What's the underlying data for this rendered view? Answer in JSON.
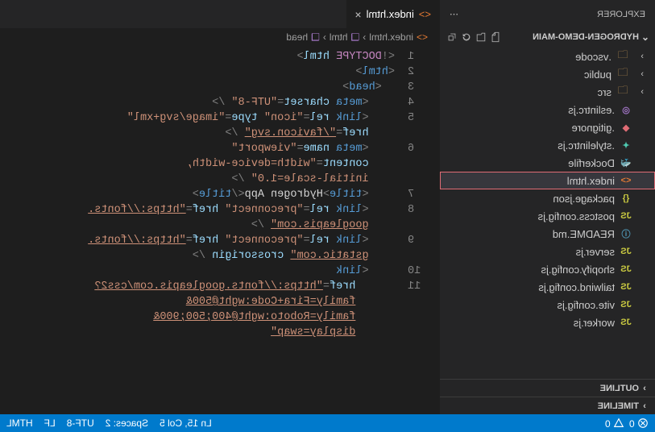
{
  "sidebar": {
    "title": "EXPLORER",
    "project": "HYDROGEN-DEMO-MAIN",
    "toolbar": {
      "newFile": "new-file",
      "newFolder": "new-folder",
      "refresh": "refresh",
      "collapse": "collapse"
    },
    "items": [
      {
        "kind": "folder",
        "label": ".vscode"
      },
      {
        "kind": "folder",
        "label": "public"
      },
      {
        "kind": "folder",
        "label": "src"
      },
      {
        "kind": "file",
        "label": ".eslintrc.js",
        "icon": "◎",
        "iconColor": "#a074c4"
      },
      {
        "kind": "file",
        "label": ".gitignore",
        "icon": "◆",
        "iconColor": "#e06c75"
      },
      {
        "kind": "file",
        "label": ".stylelintrc.js",
        "icon": "✦",
        "iconColor": "#4ec9b0"
      },
      {
        "kind": "file",
        "label": "Dockerfile",
        "icon": "🐳",
        "iconColor": "#519aba"
      },
      {
        "kind": "file",
        "label": "index.html",
        "icon": "<>",
        "iconColor": "#e37933",
        "selected": true
      },
      {
        "kind": "file",
        "label": "package.json",
        "icon": "{}",
        "iconColor": "#cbcb41"
      },
      {
        "kind": "file",
        "label": "postcss.config.js",
        "icon": "JS",
        "iconColor": "#cbcb41"
      },
      {
        "kind": "file",
        "label": "README.md",
        "icon": "ⓘ",
        "iconColor": "#519aba"
      },
      {
        "kind": "file",
        "label": "server.js",
        "icon": "JS",
        "iconColor": "#cbcb41"
      },
      {
        "kind": "file",
        "label": "shopify.config.js",
        "icon": "JS",
        "iconColor": "#cbcb41"
      },
      {
        "kind": "file",
        "label": "tailwind.config.js",
        "icon": "JS",
        "iconColor": "#cbcb41"
      },
      {
        "kind": "file",
        "label": "vite.config.js",
        "icon": "JS",
        "iconColor": "#cbcb41"
      },
      {
        "kind": "file",
        "label": "worker.js",
        "icon": "JS",
        "iconColor": "#cbcb41"
      }
    ],
    "sections": [
      {
        "label": "OUTLINE"
      },
      {
        "label": "TIMELINE"
      }
    ]
  },
  "tab": {
    "label": "index.html",
    "fileIcon": "<>"
  },
  "breadcrumb": {
    "file": "index.html",
    "path": [
      "html",
      "head"
    ]
  },
  "code": {
    "lines": [
      {
        "n": 1,
        "segs": [
          [
            "p",
            "<!"
          ],
          [
            "k",
            "DOCTYPE"
          ],
          [
            "tx",
            " "
          ],
          [
            "a",
            "html"
          ],
          [
            "p",
            ">"
          ]
        ],
        "ind": 0
      },
      {
        "n": 2,
        "segs": [
          [
            "p",
            "<"
          ],
          [
            "t",
            "html"
          ],
          [
            "p",
            ">"
          ]
        ],
        "ind": 0
      },
      {
        "n": 3,
        "segs": [
          [
            "p",
            "<"
          ],
          [
            "t",
            "head"
          ],
          [
            "p",
            ">"
          ]
        ],
        "ind": 1
      },
      {
        "n": 4,
        "segs": [
          [
            "p",
            "<"
          ],
          [
            "t",
            "meta"
          ],
          [
            "tx",
            " "
          ],
          [
            "a",
            "charset"
          ],
          [
            "p",
            "="
          ],
          [
            "s",
            "\"UTF-8\""
          ],
          [
            "tx",
            " "
          ],
          [
            "p",
            "/>"
          ]
        ],
        "ind": 2
      },
      {
        "n": 5,
        "segs": [
          [
            "p",
            "<"
          ],
          [
            "t",
            "link"
          ],
          [
            "tx",
            " "
          ],
          [
            "a",
            "rel"
          ],
          [
            "p",
            "="
          ],
          [
            "s",
            "\"icon\""
          ],
          [
            "tx",
            " "
          ],
          [
            "a",
            "type"
          ],
          [
            "p",
            "="
          ],
          [
            "s",
            "\"image/svg+xml\""
          ],
          [
            "tx",
            " "
          ]
        ],
        "ind": 2
      },
      {
        "n": "",
        "segs": [
          [
            "a",
            "href"
          ],
          [
            "p",
            "="
          ],
          [
            "su",
            "\"/favicon.svg\""
          ],
          [
            "tx",
            " "
          ],
          [
            "p",
            "/>"
          ]
        ],
        "ind": 2
      },
      {
        "n": 6,
        "segs": [
          [
            "p",
            "<"
          ],
          [
            "t",
            "meta"
          ],
          [
            "tx",
            " "
          ],
          [
            "a",
            "name"
          ],
          [
            "p",
            "="
          ],
          [
            "s",
            "\"viewport\""
          ],
          [
            "tx",
            " "
          ]
        ],
        "ind": 2
      },
      {
        "n": "",
        "segs": [
          [
            "a",
            "content"
          ],
          [
            "p",
            "="
          ],
          [
            "s",
            "\"width=device-width, "
          ]
        ],
        "ind": 2
      },
      {
        "n": "",
        "segs": [
          [
            "s",
            "initial-scale=1.0\""
          ],
          [
            "tx",
            " "
          ],
          [
            "p",
            "/>"
          ]
        ],
        "ind": 2
      },
      {
        "n": 7,
        "segs": [
          [
            "p",
            "<"
          ],
          [
            "t",
            "title"
          ],
          [
            "p",
            ">"
          ],
          [
            "tx",
            "Hydrogen App"
          ],
          [
            "p",
            "</"
          ],
          [
            "t",
            "title"
          ],
          [
            "p",
            ">"
          ]
        ],
        "ind": 2
      },
      {
        "n": 8,
        "segs": [
          [
            "p",
            "<"
          ],
          [
            "t",
            "link"
          ],
          [
            "tx",
            " "
          ],
          [
            "a",
            "rel"
          ],
          [
            "p",
            "="
          ],
          [
            "s",
            "\"preconnect\""
          ],
          [
            "tx",
            " "
          ],
          [
            "a",
            "href"
          ],
          [
            "p",
            "="
          ],
          [
            "su",
            "\"https://fonts."
          ]
        ],
        "ind": 2
      },
      {
        "n": "",
        "segs": [
          [
            "su",
            "googleapis.com\""
          ],
          [
            "tx",
            " "
          ],
          [
            "p",
            "/>"
          ]
        ],
        "ind": 2
      },
      {
        "n": 9,
        "segs": [
          [
            "p",
            "<"
          ],
          [
            "t",
            "link"
          ],
          [
            "tx",
            " "
          ],
          [
            "a",
            "rel"
          ],
          [
            "p",
            "="
          ],
          [
            "s",
            "\"preconnect\""
          ],
          [
            "tx",
            " "
          ],
          [
            "a",
            "href"
          ],
          [
            "p",
            "="
          ],
          [
            "su",
            "\"https://fonts."
          ]
        ],
        "ind": 2
      },
      {
        "n": "",
        "segs": [
          [
            "su",
            "gstatic.com\""
          ],
          [
            "tx",
            " "
          ],
          [
            "a",
            "crossorigin"
          ],
          [
            "tx",
            " "
          ],
          [
            "p",
            "/>"
          ]
        ],
        "ind": 2
      },
      {
        "n": 10,
        "segs": [
          [
            "p",
            "<"
          ],
          [
            "t",
            "link"
          ]
        ],
        "ind": 2
      },
      {
        "n": 11,
        "segs": [
          [
            "a",
            "href"
          ],
          [
            "p",
            "="
          ],
          [
            "su",
            "\"https://fonts.googleapis.com/css2?"
          ]
        ],
        "ind": 3
      },
      {
        "n": "",
        "segs": [
          [
            "su",
            "family=Fira+Code:wght@500&"
          ]
        ],
        "ind": 3
      },
      {
        "n": "",
        "segs": [
          [
            "su",
            "family=Roboto:wght@400;500;900&"
          ]
        ],
        "ind": 3
      },
      {
        "n": "",
        "segs": [
          [
            "su",
            "display=swap\""
          ]
        ],
        "ind": 3
      }
    ]
  },
  "status": {
    "errors": "0",
    "warnings": "0",
    "cursor": "Ln 15, Col 5",
    "spaces": "Spaces: 2",
    "encoding": "UTF-8",
    "eol": "LF",
    "language": "HTML"
  }
}
